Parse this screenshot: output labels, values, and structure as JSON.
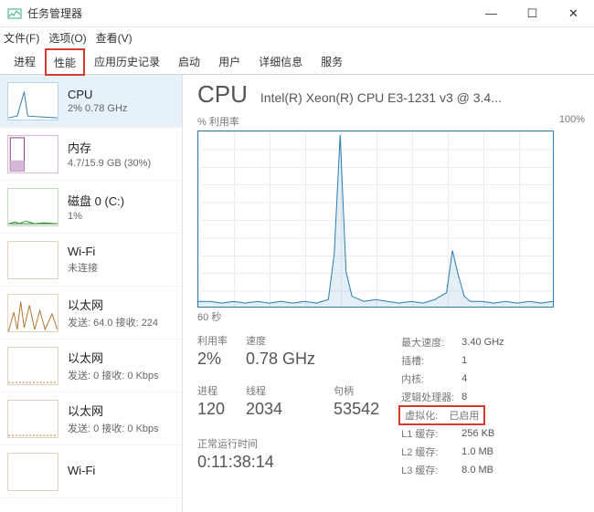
{
  "window": {
    "title": "任务管理器",
    "minimize": "—",
    "maximize": "☐",
    "close": "✕"
  },
  "menu": {
    "file": "文件(F)",
    "options": "选项(O)",
    "view": "查看(V)"
  },
  "tabs": [
    "进程",
    "性能",
    "应用历史记录",
    "启动",
    "用户",
    "详细信息",
    "服务"
  ],
  "sidebar": [
    {
      "name": "CPU",
      "sub": "2% 0.78 GHz",
      "color": "#2a7ab0",
      "selected": true
    },
    {
      "name": "内存",
      "sub": "4.7/15.9 GB (30%)",
      "color": "#8a2f8a"
    },
    {
      "name": "磁盘 0 (C:)",
      "sub": "1%",
      "color": "#3a8f3a"
    },
    {
      "name": "Wi-Fi",
      "sub": "未连接",
      "color": "#b06f2a"
    },
    {
      "name": "以太网",
      "sub": "发送: 64.0 接收: 224",
      "color": "#b06f2a"
    },
    {
      "name": "以太网",
      "sub": "发送: 0 接收: 0 Kbps",
      "color": "#b06f2a"
    },
    {
      "name": "以太网",
      "sub": "发送: 0 接收: 0 Kbps",
      "color": "#b06f2a"
    },
    {
      "name": "Wi-Fi",
      "sub": "",
      "color": "#b06f2a"
    }
  ],
  "cpu": {
    "heading": "CPU",
    "model": "Intel(R) Xeon(R) CPU E3-1231 v3 @ 3.4...",
    "util_label": "% 利用率",
    "util_max": "100%",
    "xaxis": "60 秒",
    "stats": {
      "util_lbl": "利用率",
      "util_val": "2%",
      "speed_lbl": "速度",
      "speed_val": "0.78 GHz",
      "proc_lbl": "进程",
      "proc_val": "120",
      "thread_lbl": "线程",
      "thread_val": "2034",
      "handle_lbl": "句柄",
      "handle_val": "53542",
      "uptime_lbl": "正常运行时间",
      "uptime_val": "0:11:38:14"
    },
    "kv": [
      {
        "k": "最大速度:",
        "v": "3.40 GHz"
      },
      {
        "k": "插槽:",
        "v": "1"
      },
      {
        "k": "内核:",
        "v": "4"
      },
      {
        "k": "逻辑处理器:",
        "v": "8"
      },
      {
        "k": "虚拟化:",
        "v": "已启用",
        "hl": true
      },
      {
        "k": "L1 缓存:",
        "v": "256 KB"
      },
      {
        "k": "L2 缓存:",
        "v": "1.0 MB"
      },
      {
        "k": "L3 缓存:",
        "v": "8.0 MB"
      }
    ]
  },
  "chart_data": {
    "type": "line",
    "title": "% 利用率",
    "xlabel": "60 秒",
    "ylabel": "% 利用率",
    "ylim": [
      0,
      100
    ],
    "xlim": [
      0,
      60
    ],
    "x": [
      0,
      2,
      4,
      6,
      8,
      10,
      12,
      14,
      16,
      18,
      20,
      22,
      23,
      24,
      25,
      26,
      28,
      30,
      32,
      34,
      36,
      38,
      40,
      42,
      43,
      44,
      45,
      46,
      48,
      50,
      52,
      54,
      56,
      58,
      60
    ],
    "values": [
      3,
      3,
      2,
      3,
      2,
      3,
      2,
      3,
      2,
      3,
      2,
      4,
      30,
      98,
      20,
      6,
      3,
      4,
      3,
      2,
      3,
      2,
      4,
      8,
      32,
      18,
      6,
      3,
      3,
      2,
      3,
      2,
      3,
      2,
      3
    ]
  }
}
